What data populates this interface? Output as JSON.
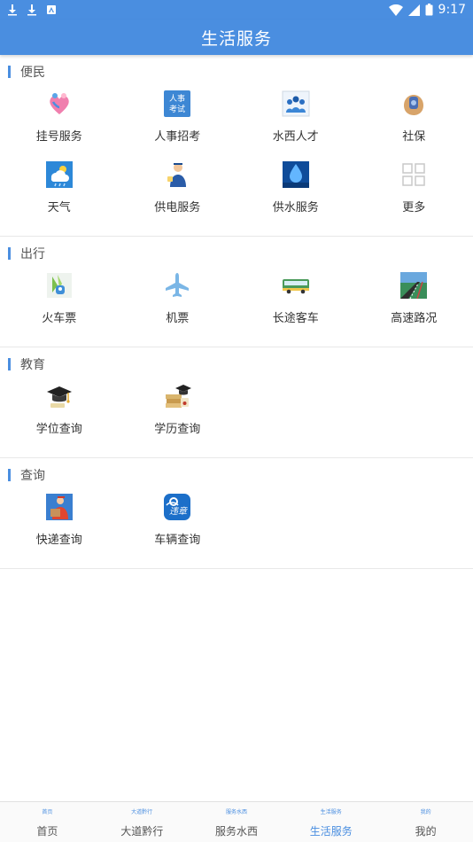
{
  "status_bar": {
    "time": "9:17"
  },
  "app_bar": {
    "title": "生活服务"
  },
  "sections": [
    {
      "title": "便民",
      "items": [
        {
          "label": "挂号服务",
          "icon": "hospital-registration-icon"
        },
        {
          "label": "人事招考",
          "icon": "personnel-exam-icon",
          "icon_text": "人事考试"
        },
        {
          "label": "水西人才",
          "icon": "talent-icon"
        },
        {
          "label": "社保",
          "icon": "social-security-icon"
        },
        {
          "label": "天气",
          "icon": "weather-icon"
        },
        {
          "label": "供电服务",
          "icon": "power-service-icon"
        },
        {
          "label": "供水服务",
          "icon": "water-service-icon"
        },
        {
          "label": "更多",
          "icon": "more-grid-icon"
        }
      ]
    },
    {
      "title": "出行",
      "items": [
        {
          "label": "火车票",
          "icon": "train-ticket-icon"
        },
        {
          "label": "机票",
          "icon": "airplane-icon"
        },
        {
          "label": "长途客车",
          "icon": "bus-icon"
        },
        {
          "label": "高速路况",
          "icon": "highway-icon"
        }
      ]
    },
    {
      "title": "教育",
      "items": [
        {
          "label": "学位查询",
          "icon": "graduation-cap-icon"
        },
        {
          "label": "学历查询",
          "icon": "diploma-icon"
        }
      ]
    },
    {
      "title": "查询",
      "items": [
        {
          "label": "快递查询",
          "icon": "express-delivery-icon"
        },
        {
          "label": "车辆查询",
          "icon": "vehicle-violation-icon",
          "icon_text": "违章"
        }
      ]
    }
  ],
  "tabs": [
    {
      "label": "首页",
      "icon_text": "首页",
      "active": false
    },
    {
      "label": "大道黔行",
      "icon_text": "大道黔行",
      "active": false
    },
    {
      "label": "服务水西",
      "icon_text": "服务水西",
      "active": false
    },
    {
      "label": "生活服务",
      "icon_text": "生活服务",
      "active": true
    },
    {
      "label": "我的",
      "icon_text": "我的",
      "active": false
    }
  ],
  "colors": {
    "primary": "#4a8ee0"
  }
}
